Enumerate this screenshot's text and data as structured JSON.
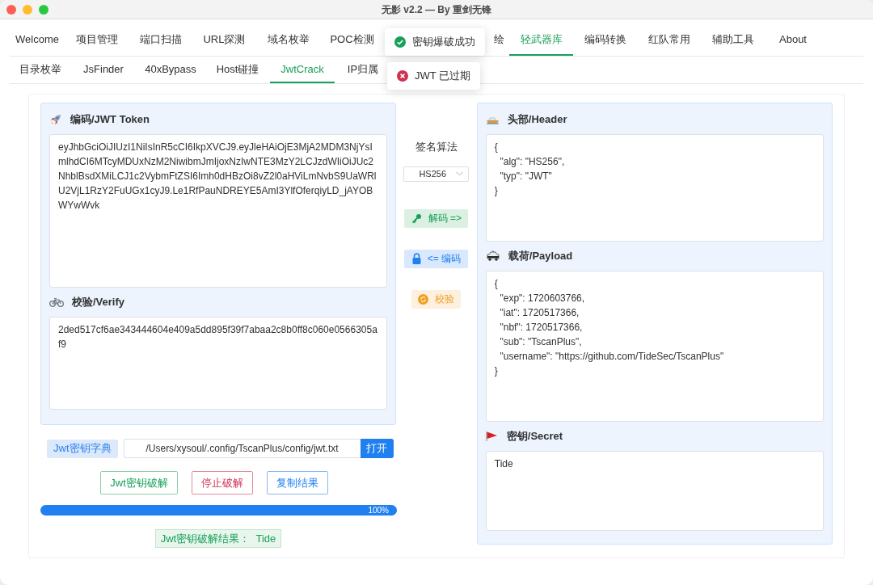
{
  "window": {
    "title": "无影 v2.2 — By 重剑无锋"
  },
  "main_tabs": [
    {
      "label": "Welcome",
      "selected": false
    },
    {
      "label": "项目管理",
      "selected": false
    },
    {
      "label": "端口扫描",
      "selected": false
    },
    {
      "label": "URL探测",
      "selected": false
    },
    {
      "label": "域名枚举",
      "selected": false
    },
    {
      "label": "POC检测",
      "selected": false
    },
    {
      "label": "绘",
      "selected": false
    },
    {
      "label": "轻武器库",
      "selected": true
    },
    {
      "label": "编码转换",
      "selected": false
    },
    {
      "label": "红队常用",
      "selected": false
    },
    {
      "label": "辅助工具",
      "selected": false
    },
    {
      "label": "About",
      "selected": false
    }
  ],
  "sub_tabs": [
    {
      "label": "目录枚举",
      "selected": false
    },
    {
      "label": "JsFinder",
      "selected": false
    },
    {
      "label": "40xBypass",
      "selected": false
    },
    {
      "label": "Host碰撞",
      "selected": false
    },
    {
      "label": "JwtCrack",
      "selected": true
    },
    {
      "label": "IP归属",
      "selected": false
    }
  ],
  "toasts": [
    {
      "kind": "success",
      "text": "密钥爆破成功"
    },
    {
      "kind": "error",
      "text": "JWT 已过期"
    }
  ],
  "token_panel": {
    "title": "编码/JWT Token",
    "value": "eyJhbGciOiJIUzI1NiIsInR5cCI6IkpXVCJ9.eyJleHAiOjE3MjA2MDM3NjYsImlhdCI6MTcyMDUxNzM2NiwibmJmIjoxNzIwNTE3MzY2LCJzdWIiOiJUc2NhblBsdXMiLCJ1c2VybmFtZSI6Imh0dHBzOi8vZ2l0aHViLmNvbS9UaWRlU2VjL1RzY2FuUGx1cyJ9.Le1RfPauNDREYE5AmI3YlfOferqiyLD_jAYOBWYwWvk"
  },
  "verify_panel": {
    "title": "校验/Verify",
    "value": "2ded517cf6ae343444604e409a5dd895f39f7abaa2c8b0ff8c060e0566305af9"
  },
  "middle": {
    "algorithm_label": "签名算法",
    "algorithm": "HS256",
    "buttons": [
      {
        "kind": "decode",
        "label": "解码 =>"
      },
      {
        "kind": "encode",
        "label": "<= 编码"
      },
      {
        "kind": "verify",
        "label": "校验"
      }
    ]
  },
  "header_panel": {
    "title": "头部/Header",
    "value": "{\n  \"alg\": \"HS256\",\n  \"typ\": \"JWT\"\n}"
  },
  "payload_panel": {
    "title": "载荷/Payload",
    "value": "{\n  \"exp\": 1720603766,\n  \"iat\": 1720517366,\n  \"nbf\": 1720517366,\n  \"sub\": \"TscanPlus\",\n  \"username\": \"https://github.com/TideSec/TscanPlus\"\n}"
  },
  "secret_panel": {
    "title": "密钥/Secret",
    "value": "Tide"
  },
  "dictionary": {
    "label": "Jwt密钥字典",
    "path": "/Users/xysoul/.config/TscanPlus/config/jwt.txt",
    "open_button": "打开"
  },
  "actions": [
    {
      "kind": "crack",
      "label": "Jwt密钥破解"
    },
    {
      "kind": "stop",
      "label": "停止破解"
    },
    {
      "kind": "copy",
      "label": "复制结果"
    }
  ],
  "progress": {
    "level": 1,
    "reading": "100%"
  },
  "result": "Jwt密钥破解结果：  Tide"
}
